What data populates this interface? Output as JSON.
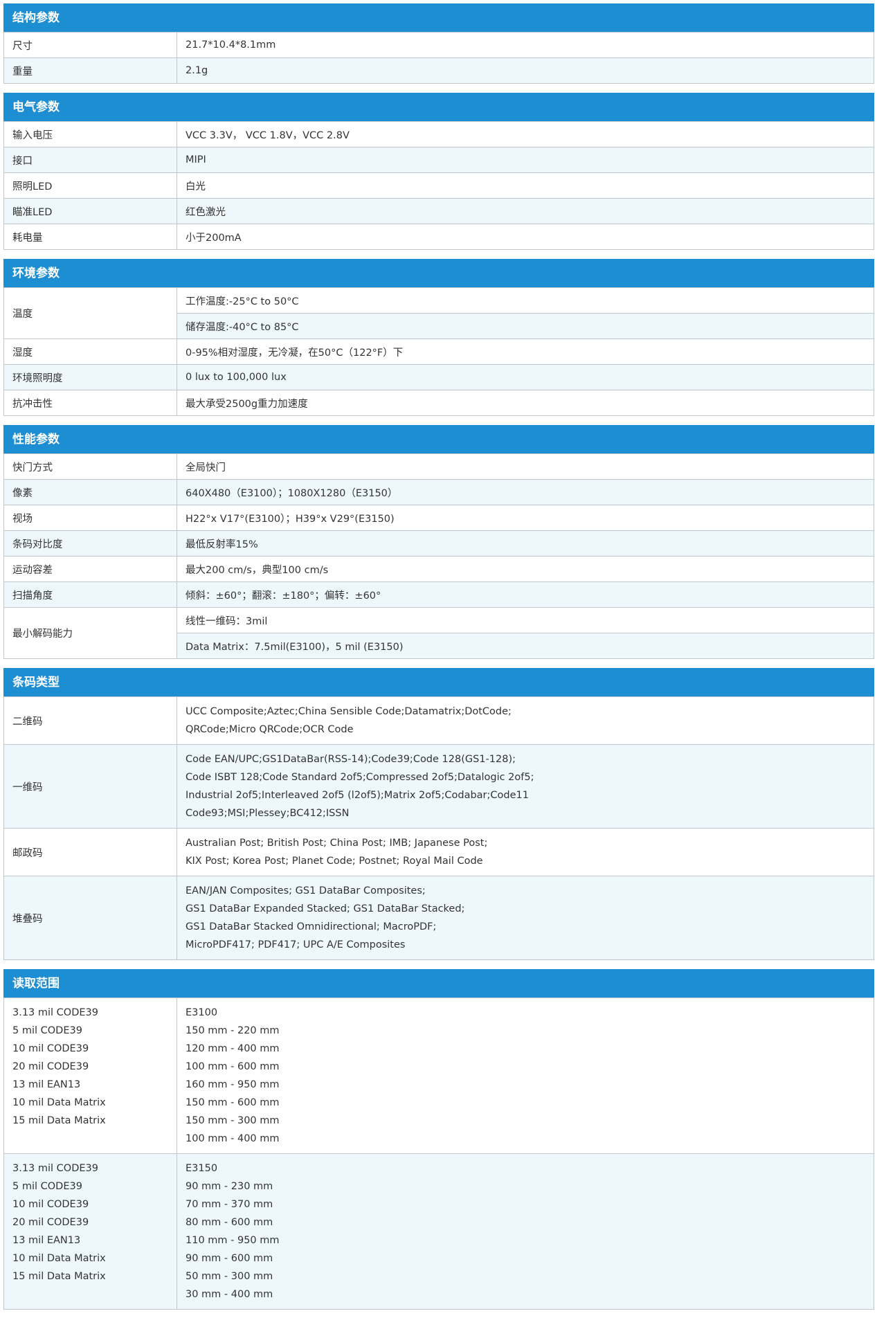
{
  "sections": {
    "structural": {
      "title": "结构参数",
      "size_label": "尺寸",
      "size_value": "21.7*10.4*8.1mm",
      "weight_label": "重量",
      "weight_value": "2.1g"
    },
    "electrical": {
      "title": "电气参数",
      "voltage_label": "输入电压",
      "voltage_value": "VCC 3.3V， VCC 1.8V，VCC 2.8V",
      "interface_label": "接口",
      "interface_value": "MIPI",
      "illum_label": "照明LED",
      "illum_value": "白光",
      "aim_label": "瞄准LED",
      "aim_value": "红色激光",
      "power_label": "耗电量",
      "power_value": "小于200mA"
    },
    "environment": {
      "title": "环境参数",
      "temp_label": "温度",
      "temp_work": "工作温度:-25°C to 50°C",
      "temp_store": "储存温度:-40°C to 85°C",
      "humidity_label": "湿度",
      "humidity_value": "0-95%相对湿度，无冷凝，在50°C（122°F）下",
      "light_label": "环境照明度",
      "light_value": "0 lux to 100,000 lux",
      "shock_label": "抗冲击性",
      "shock_value": "最大承受2500g重力加速度"
    },
    "performance": {
      "title": "性能参数",
      "shutter_label": "快门方式",
      "shutter_value": "全局快门",
      "pixel_label": "像素",
      "pixel_value": "640X480（E3100）；1080X1280（E3150）",
      "fov_label": "视场",
      "fov_value": "H22°x V17°(E3100）；H39°x V29°(E3150)",
      "contrast_label": "条码对比度",
      "contrast_value": "最低反射率15%",
      "motion_label": "运动容差",
      "motion_value": "最大200 cm/s，典型100 cm/s",
      "angle_label": "扫描角度",
      "angle_value": "倾斜：±60°；翻滚：±180°；偏转：±60°",
      "decode_label": "最小解码能力",
      "decode_1d": "线性一维码：3mil",
      "decode_dm": "Data Matrix：7.5mil(E3100)，5 mil (E3150)"
    },
    "barcode": {
      "title": "条码类型",
      "twod_label": "二维码",
      "twod_lines": [
        "UCC Composite;Aztec;China Sensible Code;Datamatrix;DotCode;",
        "QRCode;Micro QRCode;OCR Code"
      ],
      "oned_label": "一维码",
      "oned_lines": [
        "Code EAN/UPC;GS1DataBar(RSS-14);Code39;Code 128(GS1-128);",
        "Code ISBT 128;Code Standard 2of5;Compressed 2of5;Datalogic 2of5;",
        "Industrial 2of5;Interleaved 2of5 (l2of5);Matrix 2of5;Codabar;Code11",
        "Code93;MSI;Plessey;BC412;ISSN"
      ],
      "postal_label": "邮政码",
      "postal_lines": [
        "Australian Post; British Post; China Post; IMB; Japanese Post;",
        "KIX Post; Korea Post; Planet Code; Postnet; Royal Mail Code"
      ],
      "stacked_label": "堆叠码",
      "stacked_lines": [
        "EAN/JAN Composites; GS1 DataBar Composites;",
        "GS1 DataBar Expanded Stacked; GS1 DataBar Stacked;",
        "GS1 DataBar Stacked Omnidirectional; MacroPDF;",
        "MicroPDF417; PDF417; UPC A/E Composites"
      ]
    },
    "range": {
      "title": "读取范围",
      "e3100_labels": [
        "3.13 mil CODE39",
        "5 mil CODE39",
        "10 mil CODE39",
        "20 mil CODE39",
        "13 mil EAN13",
        "10 mil Data Matrix",
        "15 mil Data Matrix"
      ],
      "e3100_values": [
        "E3100",
        "150 mm - 220 mm",
        "120 mm - 400 mm",
        "100 mm - 600 mm",
        "160 mm - 950 mm",
        "150 mm - 600 mm",
        "150 mm - 300 mm",
        "100 mm - 400 mm"
      ],
      "e3150_labels": [
        "3.13 mil CODE39",
        "5 mil CODE39",
        "10 mil CODE39",
        "20 mil CODE39",
        "13 mil EAN13",
        "10 mil Data Matrix",
        "15 mil Data Matrix"
      ],
      "e3150_values": [
        "E3150",
        "90 mm - 230 mm",
        "70 mm - 370 mm",
        "80 mm - 600 mm",
        "110 mm - 950 mm",
        "90 mm - 600 mm",
        "50 mm - 300 mm",
        "30 mm - 400 mm"
      ]
    }
  }
}
